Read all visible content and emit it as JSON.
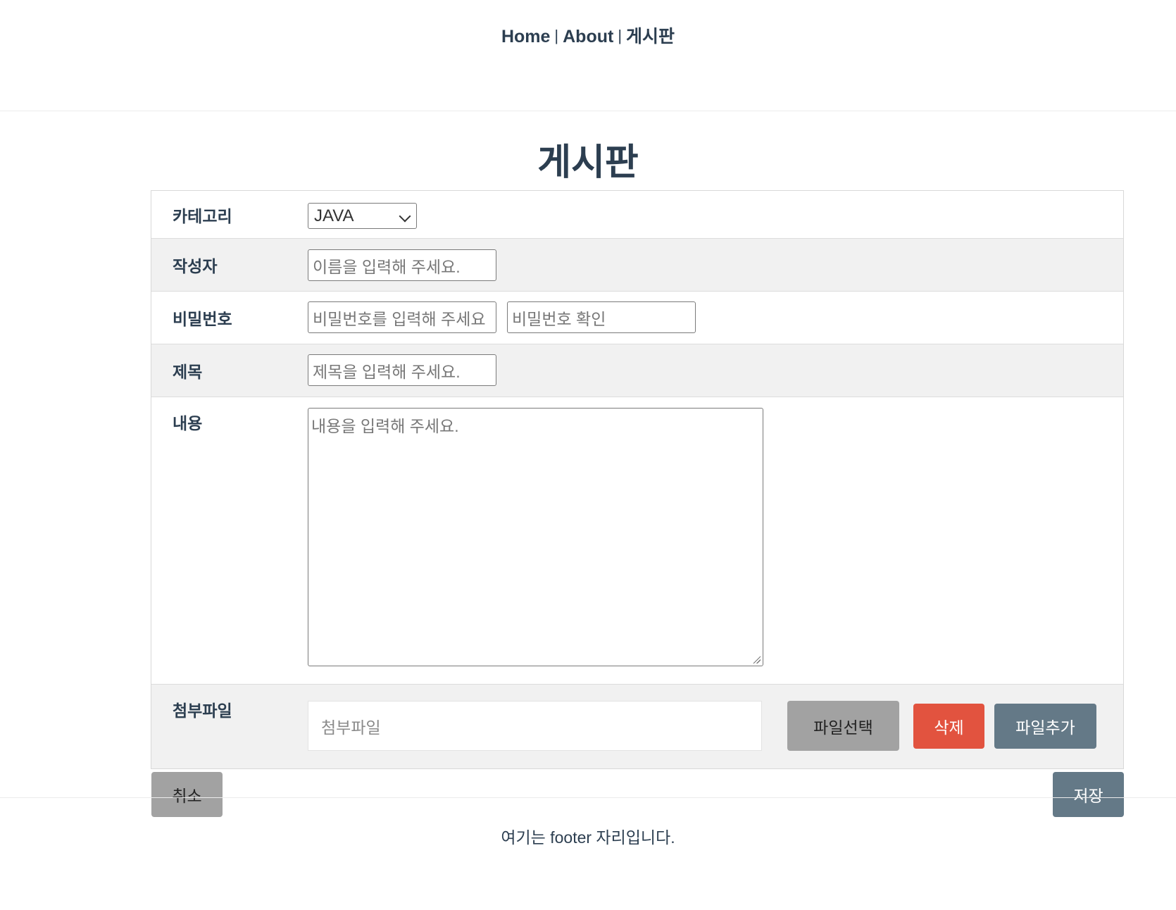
{
  "nav": {
    "items": [
      "Home",
      "About",
      "게시판"
    ],
    "separator": "|"
  },
  "page_title": "게시판",
  "form": {
    "category": {
      "label": "카테고리",
      "value": "JAVA"
    },
    "writer": {
      "label": "작성자",
      "placeholder": "이름을 입력해 주세요."
    },
    "password": {
      "label": "비밀번호",
      "placeholder": "비밀번호를 입력해 주세요",
      "confirm_placeholder": "비밀번호 확인"
    },
    "title": {
      "label": "제목",
      "placeholder": "제목을 입력해 주세요."
    },
    "content": {
      "label": "내용",
      "placeholder": "내용을 입력해 주세요."
    },
    "attachment": {
      "label": "첨부파일",
      "placeholder": "첨부파일",
      "select_label": "파일선택",
      "delete_label": "삭제",
      "add_label": "파일추가"
    }
  },
  "actions": {
    "cancel_label": "취소",
    "save_label": "저장"
  },
  "footer": {
    "text": "여기는 footer 자리입니다."
  },
  "colors": {
    "text": "#2c3e50",
    "gray_button": "#a2a2a2",
    "delete_button": "#e2533f",
    "slate_button": "#647987",
    "row_gray": "#f1f1f1"
  }
}
